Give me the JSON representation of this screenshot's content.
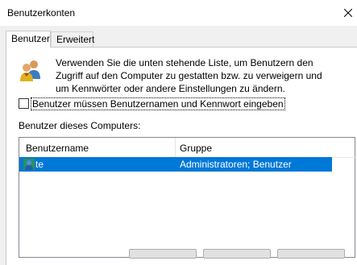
{
  "window": {
    "title": "Benutzerkonten"
  },
  "tabs": [
    {
      "label": "Benutzer"
    },
    {
      "label": "Erweitert"
    }
  ],
  "description": "Verwenden Sie die unten stehende Liste, um Benutzern den Zugriff auf den Computer zu gestatten bzw. zu verweigern und um Kennwörter oder andere Einstellungen zu ändern.",
  "checkbox": {
    "label": "Benutzer müssen Benutzernamen und Kennwort eingeben",
    "checked": false
  },
  "users_section": {
    "label": "Benutzer dieses Computers:",
    "columns": [
      "Benutzername",
      "Gruppe"
    ],
    "rows": [
      {
        "name": "te",
        "group": "Administratoren; Benutzer",
        "selected": true
      }
    ]
  },
  "icons": {
    "header": "users-icon",
    "row": "user-icon",
    "close": "close-icon"
  },
  "colors": {
    "selection": "#0078d7",
    "titlebar": "#ffffff",
    "dialog_bg": "#f0f0f0"
  }
}
